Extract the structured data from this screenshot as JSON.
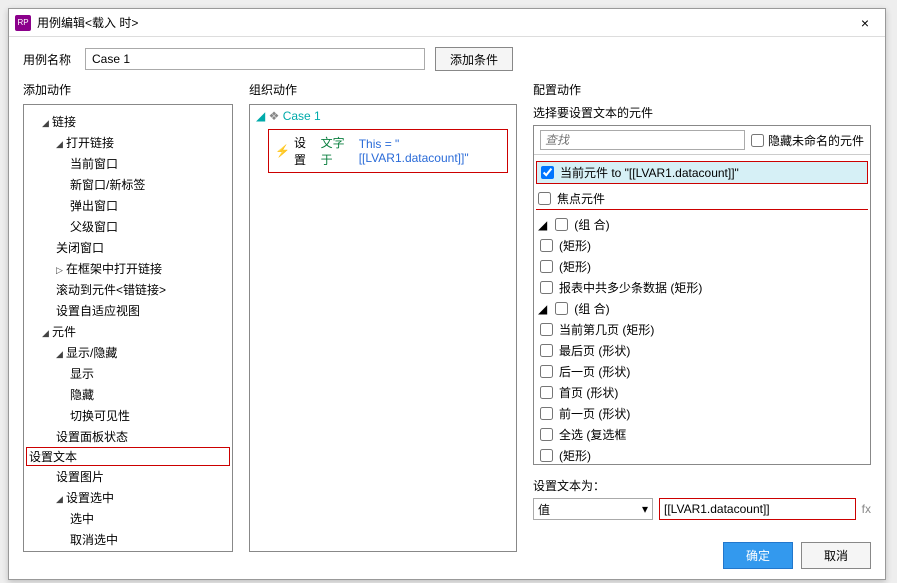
{
  "title": "用例编辑<载入 时>",
  "caseNameLabel": "用例名称",
  "caseNameValue": "Case 1",
  "addConditionBtn": "添加条件",
  "sections": {
    "add": "添加动作",
    "org": "组织动作",
    "cfg": "配置动作"
  },
  "leftTree": {
    "link": "链接",
    "openLink": "打开链接",
    "curWin": "当前窗口",
    "newWin": "新窗口/新标签",
    "popup": "弹出窗口",
    "parentWin": "父级窗口",
    "closeWin": "关闭窗口",
    "frameOpen": "在框架中打开链接",
    "scrollTo": "滚动到元件<错链接>",
    "setView": "设置自适应视图",
    "component": "元件",
    "showHide": "显示/隐藏",
    "show": "显示",
    "hide": "隐藏",
    "toggle": "切换可见性",
    "panelState": "设置面板状态",
    "setText": "设置文本",
    "setImage": "设置图片",
    "setSelect": "设置选中",
    "select": "选中",
    "unselect": "取消选中"
  },
  "midCase": "Case 1",
  "midAction": {
    "prefix": "设置",
    "green": "文字于",
    "blue": "This = \"[[LVAR1.datacount]]\""
  },
  "right": {
    "selectLabel": "选择要设置文本的元件",
    "searchPlaceholder": "查找",
    "hideUnnamed": "隐藏未命名的元件",
    "currentComp": "当前元件 to \"[[LVAR1.datacount]]\"",
    "focusComp": "焦点元件",
    "group": "(组 合)",
    "rect": "(矩形)",
    "tableCount": "报表中共多少条数据 (矩形)",
    "curPage": "当前第几页 (矩形)",
    "lastPage": "最后页 (形状)",
    "nextPage": "后一页 (形状)",
    "firstPage": "首页 (形状)",
    "prevPage": "前一页 (形状)",
    "selectAll": "全选 (复选框",
    "setTextTo": "设置文本为：",
    "valueOption": "值",
    "valueInput": "[[LVAR1.datacount]]",
    "fx": "fx"
  },
  "footer": {
    "ok": "确定",
    "cancel": "取消"
  }
}
